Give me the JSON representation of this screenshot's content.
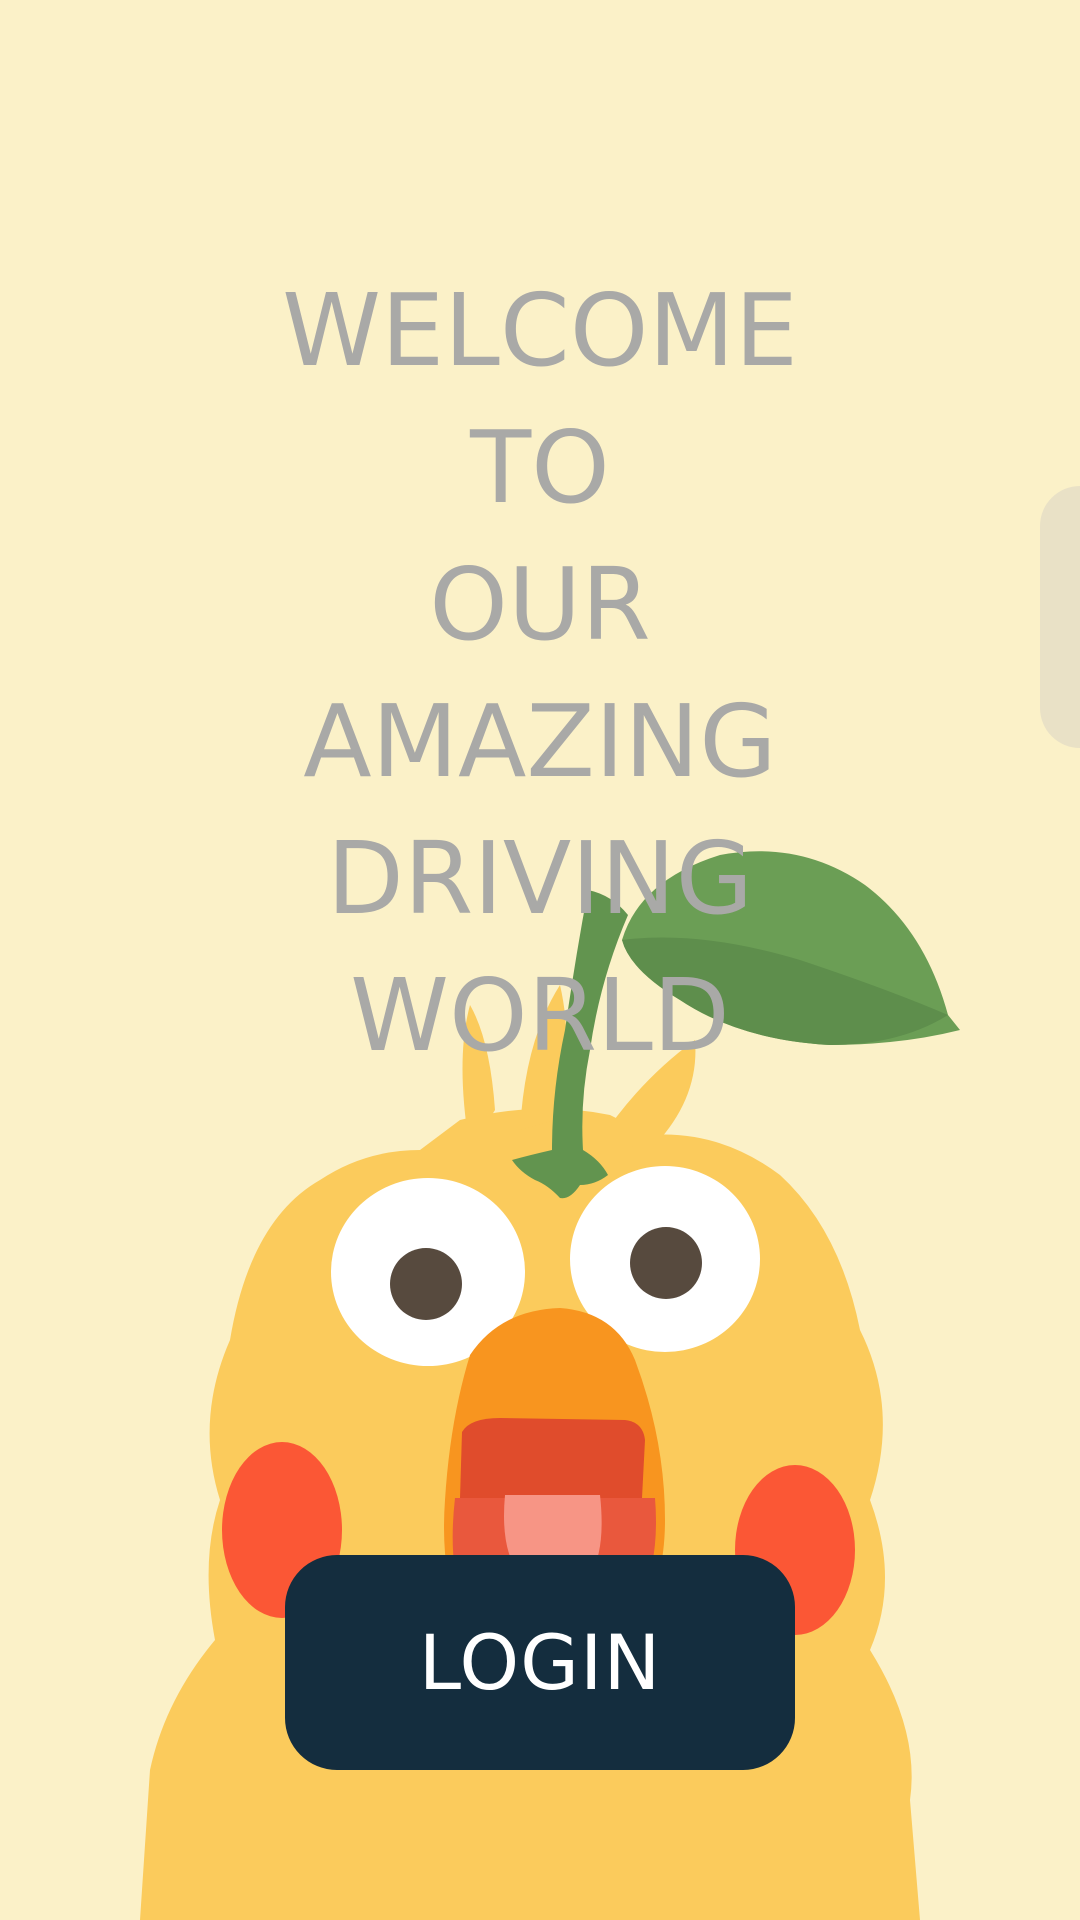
{
  "screen": {
    "background_color": "#fbf1c8"
  },
  "welcome": {
    "lines": [
      "WELCOME",
      "TO",
      "OUR",
      "AMAZING",
      "DRIVING",
      "WORLD"
    ],
    "text_color": "#a9a9a7"
  },
  "login": {
    "label": "LOGIN",
    "background_color": "#142d3e",
    "text_color": "#ffffff"
  },
  "mascot": {
    "icon": "chick-with-leaf-icon",
    "body_color": "#fbcb5c",
    "beak_color": "#f8951f",
    "cheek_color": "#fb5735",
    "leaf_color": "#6b9e55"
  }
}
